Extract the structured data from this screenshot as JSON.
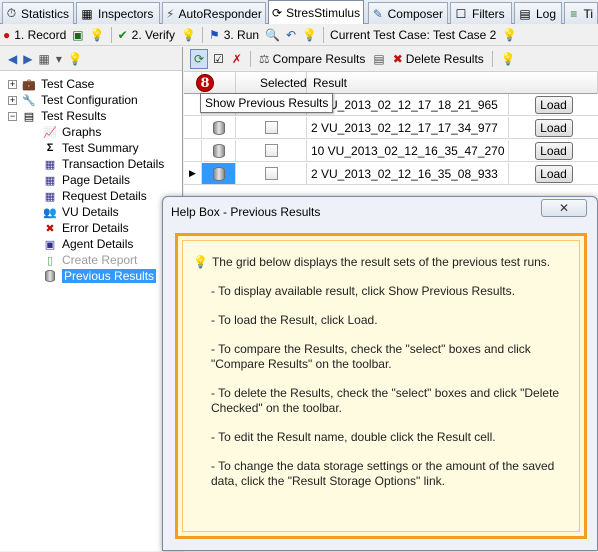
{
  "tabs": [
    {
      "label": "Statistics",
      "icon": "stopwatch-icon"
    },
    {
      "label": "Inspectors",
      "icon": "inspect-icon"
    },
    {
      "label": "AutoResponder",
      "icon": "lightning-icon"
    },
    {
      "label": "StresStimulus",
      "icon": "stresstimulus-icon"
    },
    {
      "label": "Composer",
      "icon": "composer-icon"
    },
    {
      "label": "Filters",
      "icon": "filter-icon"
    },
    {
      "label": "Log",
      "icon": "log-icon"
    },
    {
      "label": "Ti",
      "icon": "timeline-icon"
    }
  ],
  "toolbar": {
    "record": "1. Record",
    "verify": "2. Verify",
    "run": "3. Run",
    "current_test_case": "Current Test Case: Test Case 2"
  },
  "tree": {
    "items": [
      {
        "label": "Test Case",
        "icon": "briefcase-icon"
      },
      {
        "label": "Test Configuration",
        "icon": "wrench-icon"
      },
      {
        "label": "Test Results",
        "icon": "results-icon"
      },
      {
        "label": "Graphs",
        "icon": "graph-icon"
      },
      {
        "label": "Test Summary",
        "icon": "sigma-icon"
      },
      {
        "label": "Transaction Details",
        "icon": "transaction-icon"
      },
      {
        "label": "Page Details",
        "icon": "page-icon"
      },
      {
        "label": "Request Details",
        "icon": "request-icon"
      },
      {
        "label": "VU Details",
        "icon": "users-icon"
      },
      {
        "label": "Error Details",
        "icon": "error-icon"
      },
      {
        "label": "Agent Details",
        "icon": "agent-icon"
      },
      {
        "label": "Create Report",
        "icon": "report-icon"
      },
      {
        "label": "Previous Results",
        "icon": "database-icon"
      }
    ]
  },
  "right_toolbar": {
    "compare": "Compare Results",
    "delete": "Delete Results"
  },
  "grid": {
    "headers": {
      "selected": "Selected",
      "result": "Result"
    },
    "load_label": "Load",
    "rows": [
      {
        "result": "2 VU_2013_02_12_17_18_21_965"
      },
      {
        "result": "2 VU_2013_02_12_17_17_34_977"
      },
      {
        "result": "10 VU_2013_02_12_16_35_47_270"
      },
      {
        "result": "2 VU_2013_02_12_16_35_08_933"
      }
    ]
  },
  "badge": "8",
  "tooltip": "Show Previous Results",
  "help": {
    "title": "Help Box - Previous Results",
    "lines": [
      "The grid below displays the result sets of the previous test runs.",
      "- To display available result, click Show Previous Results.",
      "- To load the Result, click Load.",
      "- To compare the Results, check the \"select\" boxes and click \"Compare Results\" on the toolbar.",
      "- To delete the Results, check the \"select\" boxes and click \"Delete Checked\" on the toolbar.",
      "- To edit the Result name, double click the Result cell.",
      "- To change the data storage settings or the amount of the saved data, click the \"Result Storage Options\" link."
    ]
  },
  "colors": {
    "accent": "#3399ff",
    "help_border": "#f0a020",
    "help_bg": "#fff8d6",
    "badge": "#c00000"
  }
}
